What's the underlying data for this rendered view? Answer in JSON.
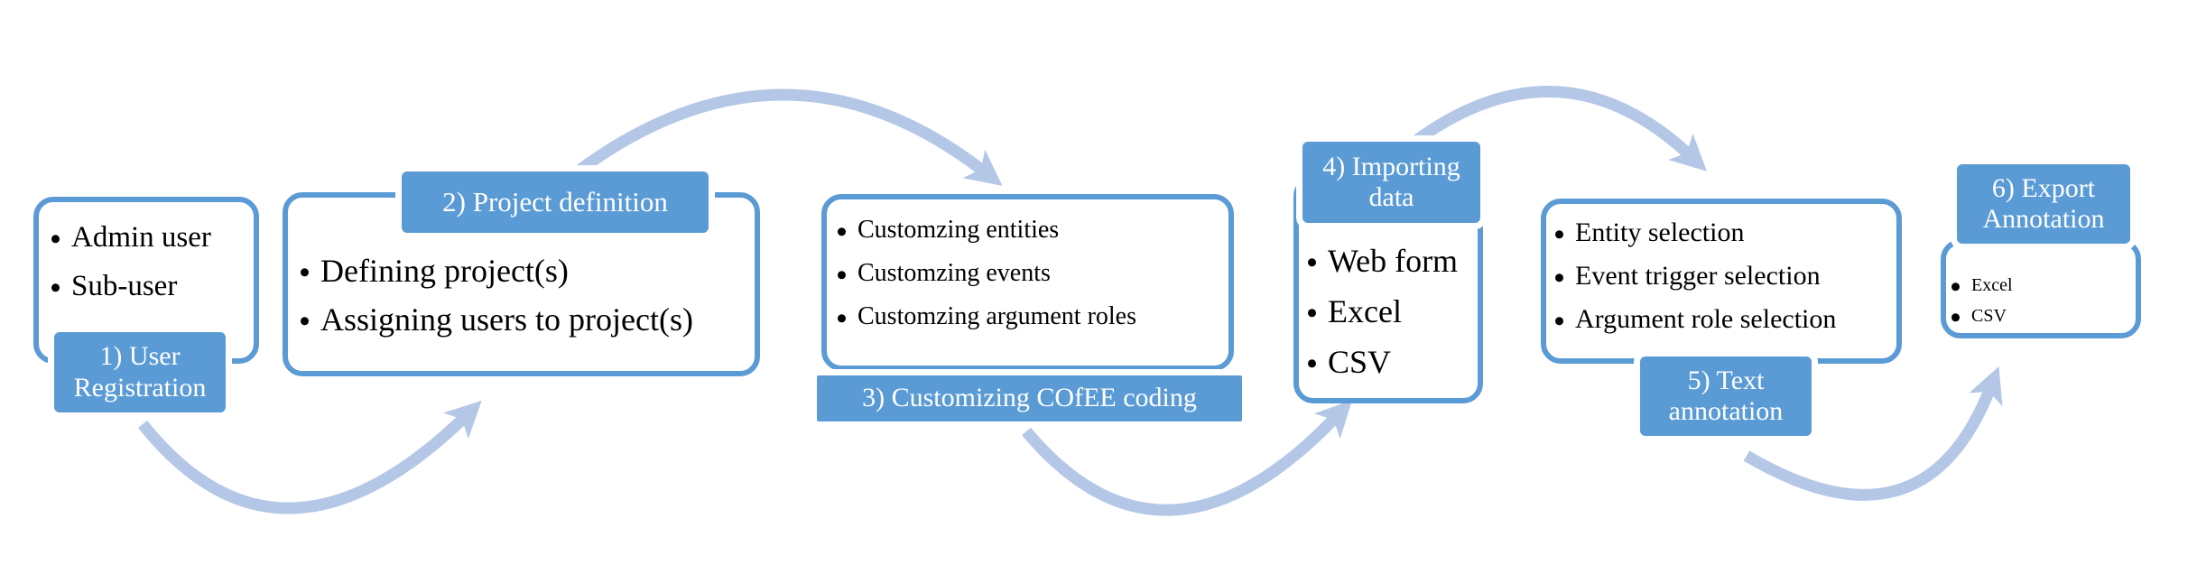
{
  "colors": {
    "border": "#5b9bd5",
    "label_fill": "#5b9bd5",
    "arrow": "#b4c7e7"
  },
  "steps": [
    {
      "label": "1) User Registration",
      "items": [
        "Admin user",
        "Sub-user"
      ]
    },
    {
      "label": "2) Project definition",
      "items": [
        "Defining project(s)",
        "Assigning users to project(s)"
      ]
    },
    {
      "label": "3) Customizing COfEE coding",
      "items": [
        "Customzing entities",
        "Customzing events",
        "Customzing argument  roles"
      ]
    },
    {
      "label": "4) Importing data",
      "items": [
        "Web form",
        "Excel",
        "CSV"
      ]
    },
    {
      "label": "5) Text annotation",
      "items": [
        "Entity selection",
        "Event trigger selection",
        "Argument role selection"
      ]
    },
    {
      "label": "6) Export Annotation",
      "items": [
        "Excel",
        "CSV"
      ]
    }
  ]
}
